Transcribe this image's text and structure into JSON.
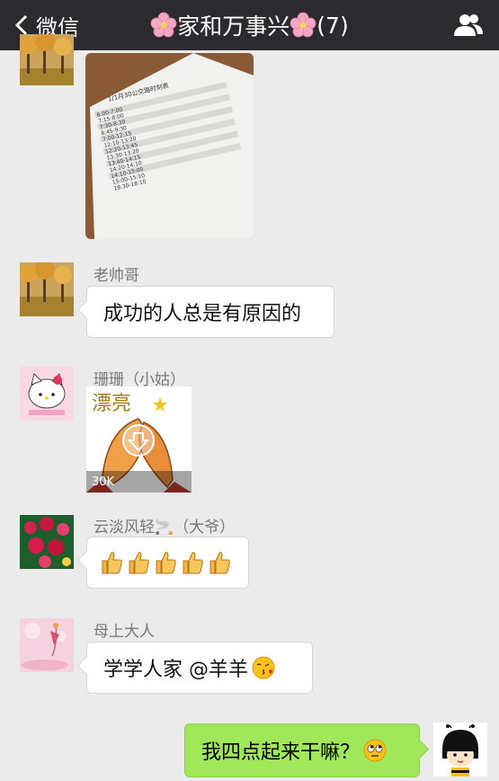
{
  "header": {
    "back_label": "微信",
    "title": "家和万事兴",
    "member_count": "(7)"
  },
  "messages": [
    {
      "name": "",
      "type": "image",
      "image_label": "document-photo"
    },
    {
      "name": "老帅哥",
      "text": "成功的人总是有原因的"
    },
    {
      "name": "珊珊（小姑）",
      "type": "sticker",
      "sticker_text": "漂亮",
      "sticker_size": "30K"
    },
    {
      "name": "云淡风轻🚬（大爷）",
      "type": "thumbs"
    },
    {
      "name": "母上大人",
      "text": "学学人家  @羊羊"
    }
  ],
  "me": {
    "text": "我四点起来干嘛？"
  },
  "document": {
    "title": "1/1月30公交路时刻表",
    "times": [
      "6:00-7:00",
      "7:15-8:00",
      "7:30-8:30",
      "8:45-9:30",
      "7:00-12:15",
      "12:10-13:20",
      "12:20-13:45",
      "13:30-13:20",
      "13:40-14:15",
      "14:20-14:10",
      "14:10-15:00",
      "15:00-15:10",
      "18:30-18:10"
    ]
  },
  "colors": {
    "topbar": "#2b2b2f",
    "background": "#ebebeb",
    "my_bubble": "#a0e75a"
  }
}
